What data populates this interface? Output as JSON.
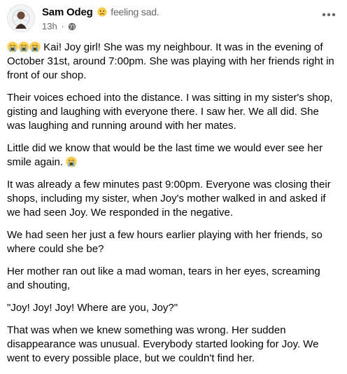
{
  "post": {
    "author": "Sam Odeg",
    "feeling_text": "feeling sad.",
    "time": "13h",
    "separator": "·",
    "paragraphs": [
      "Kai! Joy girl! She was my neighbour. It was in the evening of October 31st, around 7:00pm. She was playing with her friends right in front of our shop.",
      "Their voices echoed into the distance. I was sitting in my sister's shop, gisting and laughing with everyone there. I saw her. We all did. She was laughing and running around with her mates.",
      "Little did we know that would be the last time we would ever see her smile again.",
      "It was already a few minutes past 9:00pm. Everyone was closing their shops, including my sister, when Joy's mother walked in and asked if we had seen Joy. We responded in the negative.",
      "We had seen her just a few hours earlier playing with her friends, so where could she be?",
      "Her mother ran out like a mad woman, tears in her eyes, screaming and shouting,",
      "\"Joy! Joy! Joy! Where are you, Joy?\"",
      "That was when we knew something was wrong. Her sudden disappearance was unusual. Everybody started looking for Joy. We went to every possible place, but we couldn't find her."
    ]
  },
  "icons": {
    "avatar": "avatar",
    "feeling": "sad-face-icon",
    "privacy": "globe-icon",
    "menu": "more-options-icon",
    "crying": "loudly-crying-face-icon"
  },
  "colors": {
    "text": "#050505",
    "secondary": "#65676b",
    "emoji_yellow": "#ffcc4d",
    "tears": "#5dadec"
  }
}
